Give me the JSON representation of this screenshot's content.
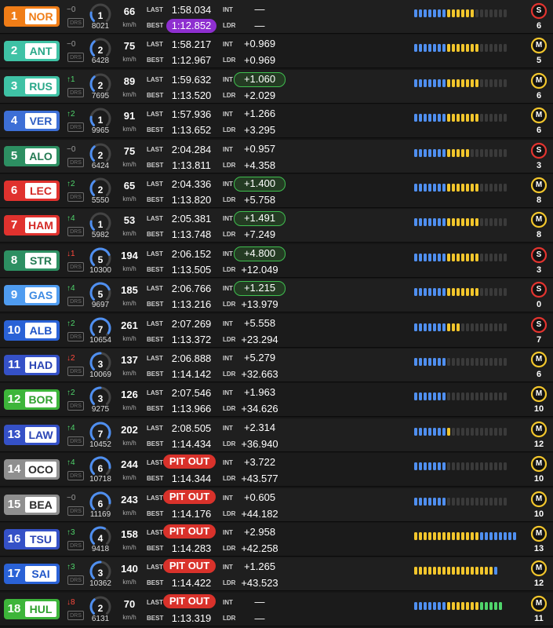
{
  "labels": {
    "last": "LAST",
    "best": "BEST",
    "int": "INT",
    "ldr": "LDR",
    "kmh": "km/h",
    "drs": "DRS"
  },
  "colors": {
    "sector_blue": "#4f8ff0",
    "sector_yellow": "#f2c62c",
    "sector_empty": "#3a3a3a",
    "tyre_soft": "#e3342f",
    "tyre_medium": "#f2c62c",
    "fastest_lap": "#8e2fd0",
    "pit": "#d9322b",
    "gap_green": "#3fbf4f"
  },
  "drivers": [
    {
      "pos": "1",
      "code": "NOR",
      "team_color": "#f07d17",
      "code_color": "#f07d17",
      "change_dir": "none",
      "change": "0",
      "gear": "1",
      "gear_fill": 0.2,
      "rpm": "8021",
      "speed": "66",
      "last": "1:58.034",
      "best": "1:12.852",
      "best_purple": true,
      "pit": false,
      "int": "—",
      "int_green": false,
      "ldr": "—",
      "sectors": {
        "blue": 7,
        "yellow": 6,
        "empty": 7
      },
      "tyre": "S",
      "tyre_age": "6"
    },
    {
      "pos": "2",
      "code": "ANT",
      "team_color": "#3fc2a5",
      "code_color": "#2aa889",
      "change_dir": "none",
      "change": "0",
      "gear": "2",
      "gear_fill": 0.35,
      "rpm": "6428",
      "speed": "75",
      "last": "1:58.217",
      "best": "1:12.967",
      "best_purple": false,
      "pit": false,
      "int": "+0.969",
      "int_green": false,
      "ldr": "+0.969",
      "sectors": {
        "blue": 7,
        "yellow": 7,
        "empty": 6
      },
      "tyre": "M",
      "tyre_age": "5"
    },
    {
      "pos": "3",
      "code": "RUS",
      "team_color": "#3fc2a5",
      "code_color": "#2aa889",
      "change_dir": "up",
      "change": "1",
      "gear": "2",
      "gear_fill": 0.35,
      "rpm": "7695",
      "speed": "89",
      "last": "1:59.632",
      "best": "1:13.520",
      "best_purple": false,
      "pit": false,
      "int": "+1.060",
      "int_green": true,
      "ldr": "+2.029",
      "sectors": {
        "blue": 7,
        "yellow": 7,
        "empty": 6
      },
      "tyre": "M",
      "tyre_age": "6"
    },
    {
      "pos": "4",
      "code": "VER",
      "team_color": "#3d6fd6",
      "code_color": "#2f5fc4",
      "change_dir": "up",
      "change": "2",
      "gear": "1",
      "gear_fill": 0.2,
      "rpm": "9965",
      "speed": "91",
      "last": "1:57.936",
      "best": "1:13.652",
      "best_purple": false,
      "pit": false,
      "int": "+1.266",
      "int_green": false,
      "ldr": "+3.295",
      "sectors": {
        "blue": 7,
        "yellow": 7,
        "empty": 6
      },
      "tyre": "M",
      "tyre_age": "6"
    },
    {
      "pos": "5",
      "code": "ALO",
      "team_color": "#2d8f62",
      "code_color": "#237a52",
      "change_dir": "none",
      "change": "0",
      "gear": "2",
      "gear_fill": 0.35,
      "rpm": "6424",
      "speed": "75",
      "last": "2:04.284",
      "best": "1:13.811",
      "best_purple": false,
      "pit": false,
      "int": "+0.957",
      "int_green": false,
      "ldr": "+4.358",
      "sectors": {
        "blue": 7,
        "yellow": 5,
        "empty": 8
      },
      "tyre": "S",
      "tyre_age": "3"
    },
    {
      "pos": "6",
      "code": "LEC",
      "team_color": "#e0322e",
      "code_color": "#d42a25",
      "change_dir": "up",
      "change": "2",
      "gear": "2",
      "gear_fill": 0.35,
      "rpm": "5550",
      "speed": "65",
      "last": "2:04.336",
      "best": "1:13.820",
      "best_purple": false,
      "pit": false,
      "int": "+1.400",
      "int_green": true,
      "ldr": "+5.758",
      "sectors": {
        "blue": 7,
        "yellow": 7,
        "empty": 6
      },
      "tyre": "M",
      "tyre_age": "8"
    },
    {
      "pos": "7",
      "code": "HAM",
      "team_color": "#e0322e",
      "code_color": "#d42a25",
      "change_dir": "up",
      "change": "4",
      "gear": "1",
      "gear_fill": 0.2,
      "rpm": "5982",
      "speed": "53",
      "last": "2:05.381",
      "best": "1:13.748",
      "best_purple": false,
      "pit": false,
      "int": "+1.491",
      "int_green": true,
      "ldr": "+7.249",
      "sectors": {
        "blue": 7,
        "yellow": 7,
        "empty": 6
      },
      "tyre": "M",
      "tyre_age": "8"
    },
    {
      "pos": "8",
      "code": "STR",
      "team_color": "#2d8f62",
      "code_color": "#237a52",
      "change_dir": "down",
      "change": "1",
      "gear": "5",
      "gear_fill": 0.75,
      "rpm": "10300",
      "speed": "194",
      "last": "2:06.152",
      "best": "1:13.505",
      "best_purple": false,
      "pit": false,
      "int": "+4.800",
      "int_green": true,
      "ldr": "+12.049",
      "sectors": {
        "blue": 7,
        "yellow": 7,
        "empty": 6
      },
      "tyre": "S",
      "tyre_age": "3"
    },
    {
      "pos": "9",
      "code": "GAS",
      "team_color": "#4f9cf0",
      "code_color": "#3c8ae3",
      "change_dir": "up",
      "change": "4",
      "gear": "5",
      "gear_fill": 0.75,
      "rpm": "9697",
      "speed": "185",
      "last": "2:06.766",
      "best": "1:13.216",
      "best_purple": false,
      "pit": false,
      "int": "+1.215",
      "int_green": true,
      "ldr": "+13.979",
      "sectors": {
        "blue": 7,
        "yellow": 7,
        "empty": 6
      },
      "tyre": "S",
      "tyre_age": "0"
    },
    {
      "pos": "10",
      "code": "ALB",
      "team_color": "#2a62d6",
      "code_color": "#1f55c8",
      "change_dir": "up",
      "change": "2",
      "gear": "7",
      "gear_fill": 0.95,
      "rpm": "10654",
      "speed": "261",
      "last": "2:07.269",
      "best": "1:13.372",
      "best_purple": false,
      "pit": false,
      "int": "+5.558",
      "int_green": false,
      "ldr": "+23.294",
      "sectors": {
        "blue": 7,
        "yellow": 3,
        "empty": 10
      },
      "tyre": "S",
      "tyre_age": "7"
    },
    {
      "pos": "11",
      "code": "HAD",
      "team_color": "#3551c7",
      "code_color": "#2b45b5",
      "change_dir": "down",
      "change": "2",
      "gear": "3",
      "gear_fill": 0.5,
      "rpm": "10069",
      "speed": "137",
      "last": "2:06.888",
      "best": "1:14.142",
      "best_purple": false,
      "pit": false,
      "int": "+5.279",
      "int_green": false,
      "ldr": "+32.663",
      "sectors": {
        "blue": 7,
        "yellow": 0,
        "empty": 13
      },
      "tyre": "M",
      "tyre_age": "6"
    },
    {
      "pos": "12",
      "code": "BOR",
      "team_color": "#3db53a",
      "code_color": "#2fa02d",
      "change_dir": "up",
      "change": "2",
      "gear": "3",
      "gear_fill": 0.5,
      "rpm": "9275",
      "speed": "126",
      "last": "2:07.546",
      "best": "1:13.966",
      "best_purple": false,
      "pit": false,
      "int": "+1.963",
      "int_green": false,
      "ldr": "+34.626",
      "sectors": {
        "blue": 7,
        "yellow": 0,
        "empty": 13
      },
      "tyre": "M",
      "tyre_age": "10"
    },
    {
      "pos": "13",
      "code": "LAW",
      "team_color": "#3551c7",
      "code_color": "#2b45b5",
      "change_dir": "up",
      "change": "4",
      "gear": "7",
      "gear_fill": 0.95,
      "rpm": "10452",
      "speed": "202",
      "last": "2:08.505",
      "best": "1:14.434",
      "best_purple": false,
      "pit": false,
      "int": "+2.314",
      "int_green": false,
      "ldr": "+36.940",
      "sectors": {
        "blue": 7,
        "yellow": 1,
        "empty": 12
      },
      "tyre": "M",
      "tyre_age": "12"
    },
    {
      "pos": "14",
      "code": "OCO",
      "team_color": "#8f8f8f",
      "code_color": "#2b2b2b",
      "change_dir": "up",
      "change": "4",
      "gear": "6",
      "gear_fill": 0.85,
      "rpm": "10718",
      "speed": "244",
      "last": "",
      "best": "1:14.344",
      "best_purple": false,
      "pit": true,
      "pit_label": "PIT OUT",
      "int": "+3.722",
      "int_green": false,
      "ldr": "+43.577",
      "sectors": {
        "blue": 7,
        "yellow": 0,
        "empty": 13
      },
      "tyre": "M",
      "tyre_age": "10"
    },
    {
      "pos": "15",
      "code": "BEA",
      "team_color": "#8f8f8f",
      "code_color": "#2b2b2b",
      "change_dir": "none",
      "change": "0",
      "gear": "6",
      "gear_fill": 0.85,
      "rpm": "11169",
      "speed": "243",
      "last": "",
      "best": "1:14.176",
      "best_purple": false,
      "pit": true,
      "pit_label": "PIT OUT",
      "int": "+0.605",
      "int_green": false,
      "ldr": "+44.182",
      "sectors": {
        "blue": 7,
        "yellow": 0,
        "empty": 13
      },
      "tyre": "M",
      "tyre_age": "10"
    },
    {
      "pos": "16",
      "code": "TSU",
      "team_color": "#3551c7",
      "code_color": "#2b45b5",
      "change_dir": "up",
      "change": "3",
      "gear": "4",
      "gear_fill": 0.6,
      "rpm": "9418",
      "speed": "158",
      "last": "",
      "best": "1:14.283",
      "best_purple": false,
      "pit": true,
      "pit_label": "PIT OUT",
      "int": "+2.958",
      "int_green": false,
      "ldr": "+42.258",
      "sectors": {
        "yellow_first": true,
        "blue": 4,
        "yellow": 14,
        "empty": 0,
        "blue_after": 4
      },
      "tyre": "M",
      "tyre_age": "13"
    },
    {
      "pos": "17",
      "code": "SAI",
      "team_color": "#2a62d6",
      "code_color": "#1f55c8",
      "change_dir": "up",
      "change": "3",
      "gear": "3",
      "gear_fill": 0.5,
      "rpm": "10362",
      "speed": "140",
      "last": "",
      "best": "1:14.422",
      "best_purple": false,
      "pit": true,
      "pit_label": "PIT OUT",
      "int": "+1.265",
      "int_green": false,
      "ldr": "+43.523",
      "sectors": {
        "yellow_first": true,
        "blue": 0,
        "yellow": 17,
        "empty": 0,
        "blue_after": 1
      },
      "tyre": "M",
      "tyre_age": "12"
    },
    {
      "pos": "18",
      "code": "HUL",
      "team_color": "#3db53a",
      "code_color": "#2fa02d",
      "change_dir": "down",
      "change": "8",
      "gear": "2",
      "gear_fill": 0.35,
      "rpm": "6131",
      "speed": "70",
      "last": "",
      "best": "1:13.319",
      "best_purple": false,
      "pit": true,
      "pit_label": "PIT OUT",
      "int": "—",
      "int_green": false,
      "ldr": "—",
      "sectors": {
        "blue": 7,
        "yellow": 7,
        "empty": 0,
        "tail_green": 5
      },
      "tyre": "M",
      "tyre_age": "11"
    }
  ]
}
